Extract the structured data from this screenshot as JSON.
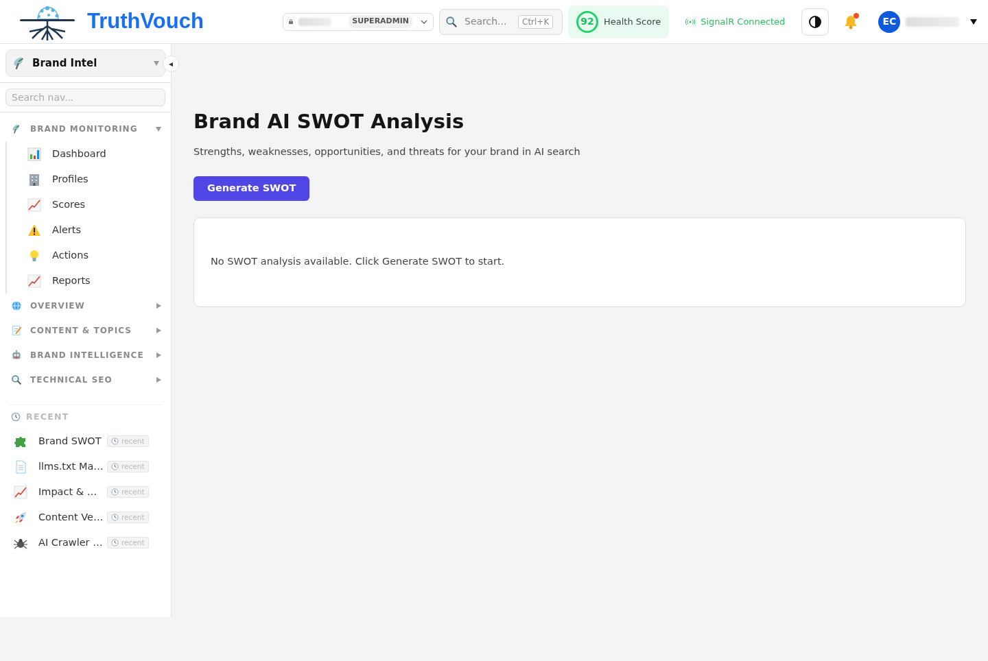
{
  "header": {
    "brand": "TruthVouch",
    "org_switcher": {
      "role": "SUPERADMIN"
    },
    "search": {
      "placeholder": "Search...",
      "shortcut": "Ctrl+K"
    },
    "health": {
      "score": "92",
      "label": "Health Score"
    },
    "connection": {
      "label": "SignalR Connected",
      "connected": true
    },
    "notifications": {
      "unread": true
    },
    "user": {
      "initials": "EC"
    }
  },
  "sidebar": {
    "module": "Brand Intel",
    "search_placeholder": "Search nav...",
    "sections": [
      {
        "title": "BRAND MONITORING",
        "expanded": true,
        "items": [
          {
            "label": "Dashboard"
          },
          {
            "label": "Profiles"
          },
          {
            "label": "Scores"
          },
          {
            "label": "Alerts"
          },
          {
            "label": "Actions"
          },
          {
            "label": "Reports"
          }
        ]
      },
      {
        "title": "OVERVIEW",
        "expanded": false
      },
      {
        "title": "CONTENT & TOPICS",
        "expanded": false
      },
      {
        "title": "BRAND INTELLIGENCE",
        "expanded": false
      },
      {
        "title": "TECHNICAL SEO",
        "expanded": false
      }
    ],
    "recent": {
      "title": "RECENT",
      "items": [
        {
          "label": "Brand SWOT",
          "tag": "recent"
        },
        {
          "label": "llms.txt Ma…",
          "tag": "recent"
        },
        {
          "label": "Impact & …",
          "tag": "recent"
        },
        {
          "label": "Content Ve…",
          "tag": "recent"
        },
        {
          "label": "AI Crawler …",
          "tag": "recent"
        }
      ]
    }
  },
  "main": {
    "title": "Brand AI SWOT Analysis",
    "subtitle": "Strengths, weaknesses, opportunities, and threats for your brand in AI search",
    "action": "Generate SWOT",
    "empty_message": "No SWOT analysis available. Click Generate SWOT to start."
  }
}
